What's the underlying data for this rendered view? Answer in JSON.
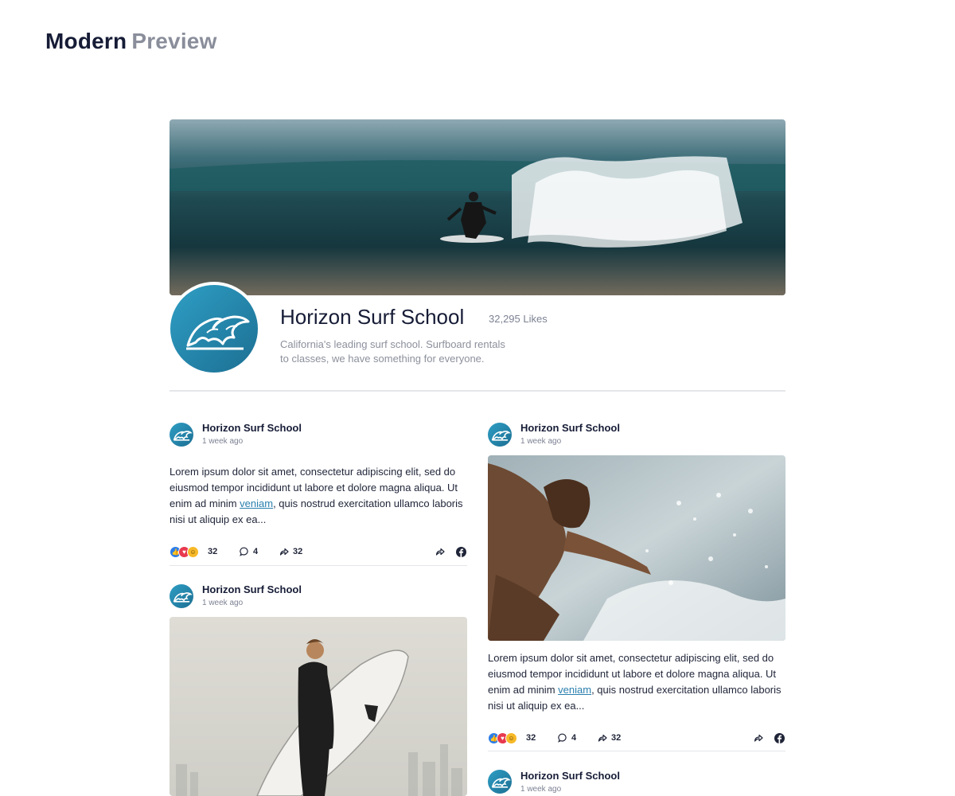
{
  "brand": {
    "primary": "Modern",
    "secondary": "Preview"
  },
  "page": {
    "name": "Horizon Surf School",
    "likes": "32,295 Likes",
    "description_line1": "California's leading surf school. Surfboard rentals",
    "description_line2": "to classes, we have something for everyone."
  },
  "posts": [
    {
      "author": "Horizon Surf School",
      "time": "1 week ago",
      "text_before_link": "Lorem ipsum dolor sit amet, consectetur adipiscing elit, sed do eiusmod tempor incididunt ut labore et dolore magna aliqua. Ut enim ad minim ",
      "link": "veniam",
      "text_after_link": ", quis nostrud exercitation ullamco laboris nisi ut aliquip ex ea...",
      "reactions": "32",
      "comments": "4",
      "shares": "32"
    },
    {
      "author": "Horizon Surf School",
      "time": "1 week ago"
    },
    {
      "author": "Horizon Surf School",
      "time": "1 week ago",
      "text_before_link": "Lorem ipsum dolor sit amet, consectetur adipiscing elit, sed do eiusmod tempor incididunt ut labore et dolore magna aliqua. Ut enim ad minim ",
      "link": "veniam",
      "text_after_link": ", quis nostrud exercitation ullamco laboris nisi ut aliquip ex ea...",
      "reactions": "32",
      "comments": "4",
      "shares": "32"
    },
    {
      "author": "Horizon Surf School",
      "time": "1 week ago"
    }
  ],
  "icons": {
    "logo": "wave-logo-icon",
    "like": "like-icon",
    "love": "love-icon",
    "haha": "haha-icon",
    "comment": "comment-icon",
    "share": "share-icon",
    "facebook": "facebook-icon"
  },
  "colors": {
    "accent": "#2a7fae",
    "brand_gradient_start": "#2f9ec4",
    "brand_gradient_end": "#1c6f93",
    "title": "#161c36",
    "muted": "#8a8e9b"
  }
}
